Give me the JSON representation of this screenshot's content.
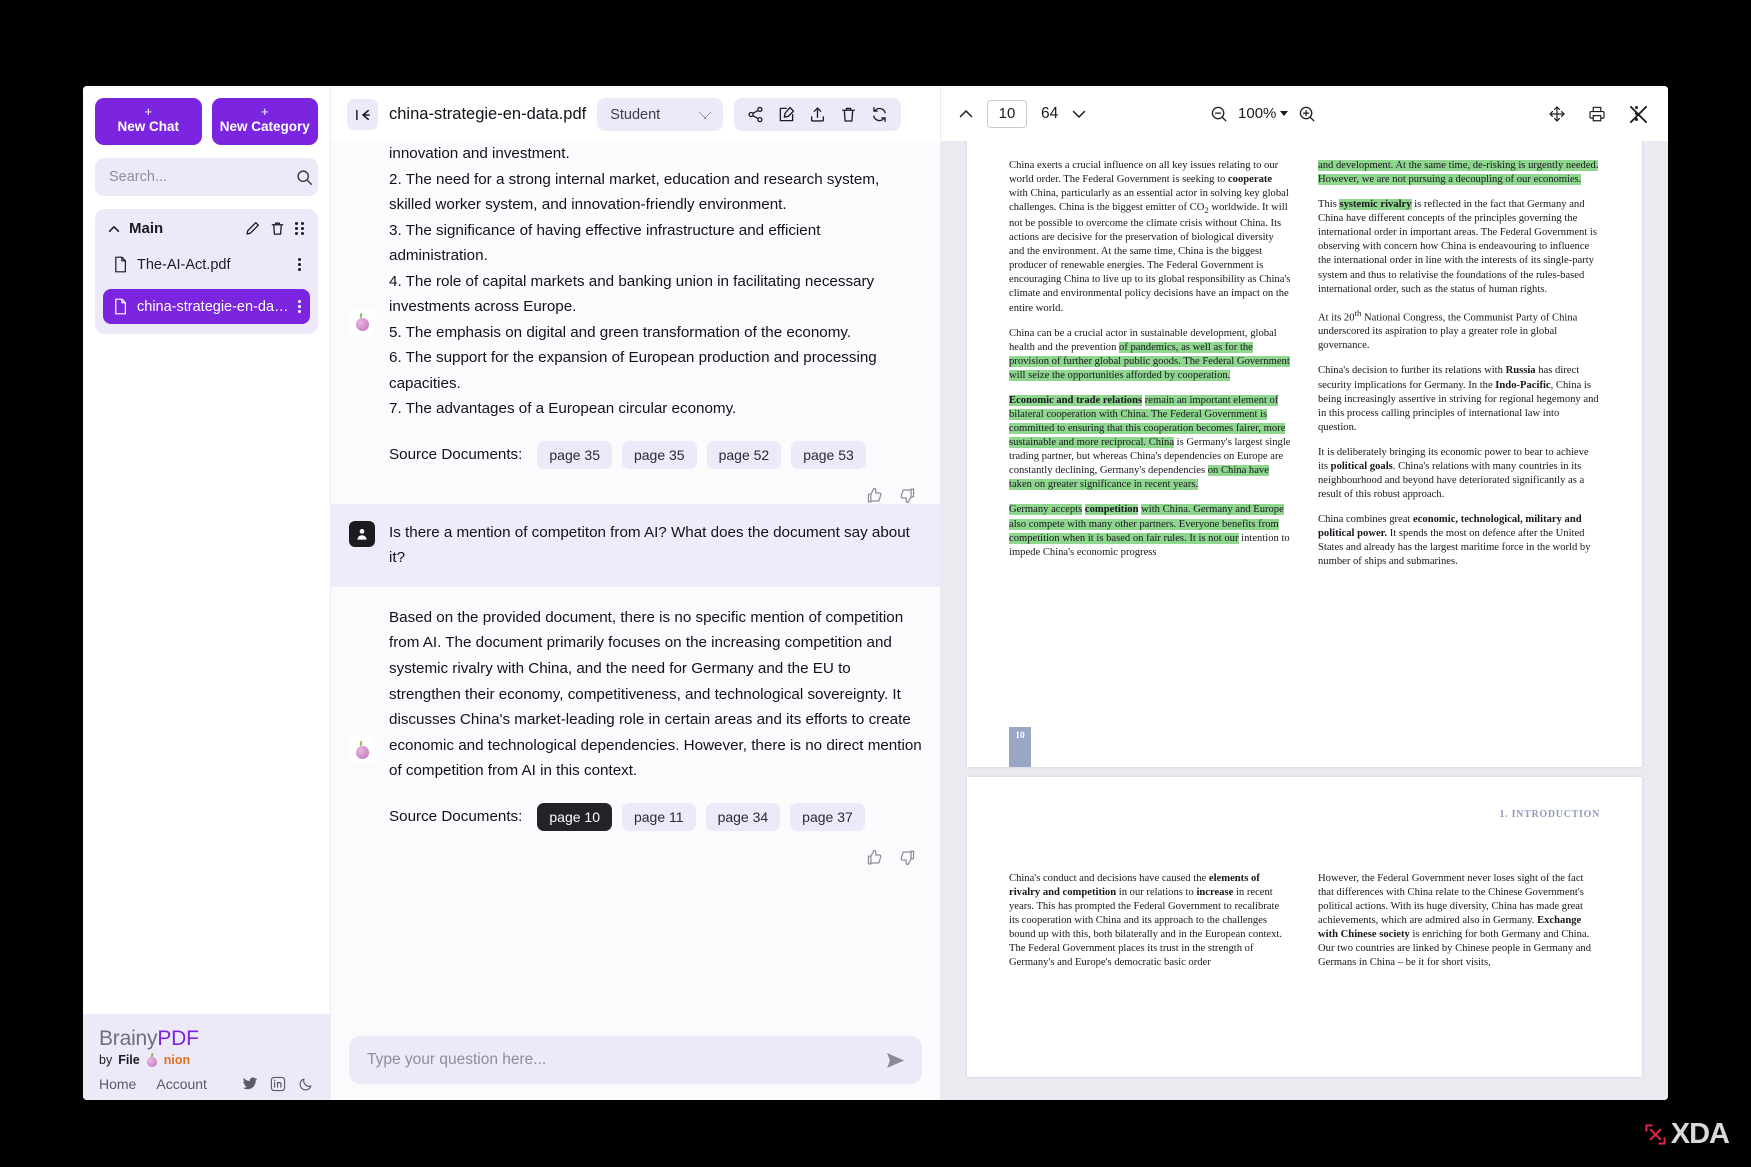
{
  "sidebar": {
    "new_chat": {
      "plus": "+",
      "label": "New Chat"
    },
    "new_category": {
      "plus": "+",
      "label": "New Category"
    },
    "search_placeholder": "Search...",
    "category": {
      "name": "Main"
    },
    "documents": [
      {
        "name": "The-AI-Act.pdf",
        "active": false
      },
      {
        "name": "china-strategie-en-data....",
        "active": true
      }
    ],
    "footer": {
      "brand_part1": "Brainy",
      "brand_part2": "PDF",
      "by": "by",
      "company_part1": "File",
      "company_part2": "nion",
      "links": [
        "Home",
        "Account"
      ]
    }
  },
  "chat": {
    "file_title": "china-strategie-en-data.pdf",
    "role_selected": "Student",
    "role_options": [
      "Student"
    ],
    "toolbar": [
      "share-icon",
      "edit-icon",
      "upload-icon",
      "delete-icon",
      "refresh-icon"
    ],
    "messages": [
      {
        "role": "assistant",
        "text": "innovation and investment.\n2. The need for a strong internal market, education and research system, skilled worker system, and innovation-friendly environment.\n3. The significance of having effective infrastructure and efficient administration.\n4. The role of capital markets and banking union in facilitating necessary investments across Europe.\n5. The emphasis on digital and green transformation of the economy.\n6. The support for the expansion of European production and processing capacities.\n7. The advantages of a European circular economy.",
        "sources_label": "Source Documents:",
        "sources": [
          {
            "label": "page 35",
            "selected": false
          },
          {
            "label": "page 35",
            "selected": false
          },
          {
            "label": "page 52",
            "selected": false
          },
          {
            "label": "page 53",
            "selected": false
          }
        ]
      },
      {
        "role": "user",
        "text": "Is there a mention of competiton from AI? What does the document say about it?"
      },
      {
        "role": "assistant",
        "text": "Based on the provided document, there is no specific mention of competition from AI. The document primarily focuses on the increasing competition and systemic rivalry with China, and the need for Germany and the EU to strengthen their economy, competitiveness, and technological sovereignty. It discusses China's market-leading role in certain areas and its efforts to create economic and technological dependencies. However, there is no direct mention of competition from AI in this context.",
        "sources_label": "Source Documents:",
        "sources": [
          {
            "label": "page 10",
            "selected": true
          },
          {
            "label": "page 11",
            "selected": false
          },
          {
            "label": "page 34",
            "selected": false
          },
          {
            "label": "page 37",
            "selected": false
          }
        ]
      }
    ],
    "composer_placeholder": "Type your question here..."
  },
  "pdf": {
    "current_page": "10",
    "total_pages": "64",
    "zoom": "100%",
    "page_marker": "10",
    "section_label": "1. INTRODUCTION",
    "page10": {
      "left": [
        "China exerts a crucial influence on all key issues relating to our world order. The Federal Government is seeking to <b>cooperate</b> with China, particularly as an essential actor in solving key global challenges. China is the biggest emitter of CO<sub>2</sub> worldwide. It will not be possible to overcome the climate crisis without China. Its actions are decisive for the preservation of biological diversity and the environment. At the same time, China is the biggest producer of renewable energies. The Federal Government is encouraging China to live up to its global responsibility as China's climate and environmental policy decisions have an impact on the entire world.",
        "China can be a crucial actor in sustainable development, global health and the prevention <span class='hl'>of pandemics, as well as for the provision of further global public goods. The Federal Government will seize the opportunities afforded by cooperation.</span>",
        "<span class='hl'><b>Economic and trade relations</b></span> <span class='hl'>remain an important element of bilateral cooperation with China. The Federal Government is committed to ensuring that this cooperation becomes fairer, more sustainable and more reciprocal. China</span> is Germany's largest single trading partner, but whereas China's dependencies on Europe are constantly declining, Germany's dependencies <span class='hl'>on China have taken on greater significance in recent years.</span>",
        "<span class='hl'>Germany accepts</span> <span class='hl'><b>competition</b></span> <span class='hl'>with China. Germany and Europe also compete with many other partners. Everyone benefits from competition when it is based on fair rules. It is not our</span> intention to impede China's economic progress"
      ],
      "right": [
        "<span class='hl'>and development. At the same time, de-risking is urgently needed. However, we are not pursuing a decoupling of our economies.</span>",
        "This <span class='hl'><b>systemic rivalry</b></span> is reflected in the fact that Germany and China have different concepts of the principles governing the international order in important areas. The Federal Government is observing with concern how China is endeavouring to influence the international order in line with the interests of its single-party system and thus to relativise the foundations of the rules-based international order, such as the status of human rights.",
        "At its 20<sup>th</sup> National Congress, the Communist Party of China underscored its aspiration to play a greater role in global governance.",
        "China's decision to further its relations with <b>Russia</b> has direct security implications for Germany. In the <b>Indo-Pacific</b>, China is being increasingly assertive in striving for regional hegemony and in this process calling principles of international law into question.",
        "It is deliberately bringing its economic power to bear to achieve its <b>political goals</b>. China's relations with many countries in its neighbourhood and beyond have deteriorated significantly as a result of this robust approach.",
        "China combines great <b>economic, technological, military and political power.</b> It spends the most on defence after the United States and already has the largest maritime force in the world by number of ships and submarines."
      ]
    },
    "page11": {
      "left": [
        "China's conduct and decisions have caused the <b>elements of rivalry and competition</b> in our relations to <b>increase</b> in recent years. This has prompted the Federal Government to recalibrate its cooperation with China and its approach to the challenges bound up with this, both bilaterally and in the European context. The Federal Government places its trust in the strength of Germany's and Europe's democratic basic order"
      ],
      "right": [
        "However, the Federal Government never loses sight of the fact that differences with China relate to the Chinese Government's political actions. With its huge diversity, China has made great achievements, which are admired also in Germany. <b>Exchange with Chinese society</b> is enriching for both Germany and China. Our two countries are linked by Chinese people in Germany and Germans in China – be it for short visits,"
      ]
    }
  },
  "watermark": {
    "text": "XDA"
  },
  "colors": {
    "accent": "#7b25e0",
    "accent_soft": "#ede9f8",
    "highlight": "#8fd68f",
    "chip_selected": "#222228"
  }
}
